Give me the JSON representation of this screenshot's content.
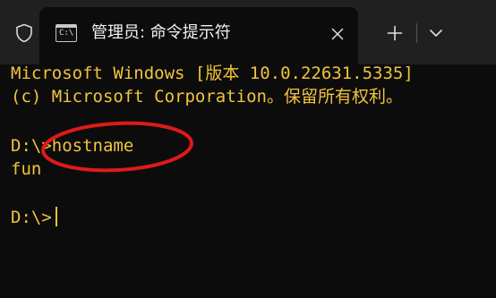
{
  "window": {
    "tab_title": "管理员: 命令提示符",
    "tab_icon_glyph": "C:\\"
  },
  "terminal": {
    "lines": [
      "Microsoft Windows [版本 10.0.22631.5335]",
      "(c) Microsoft Corporation。保留所有权利。",
      "",
      "D:\\>hostname",
      "fun",
      "",
      "D:\\>"
    ]
  },
  "colors": {
    "terminal_text": "#f0c43c",
    "terminal_bg": "#0c0c0c",
    "titlebar_bg": "#202020",
    "annotation": "#e01919"
  },
  "icons": {
    "shield": "shield-icon",
    "tab": "command-prompt-icon",
    "close": "close-icon",
    "new_tab": "plus-icon",
    "dropdown": "chevron-down-icon"
  }
}
